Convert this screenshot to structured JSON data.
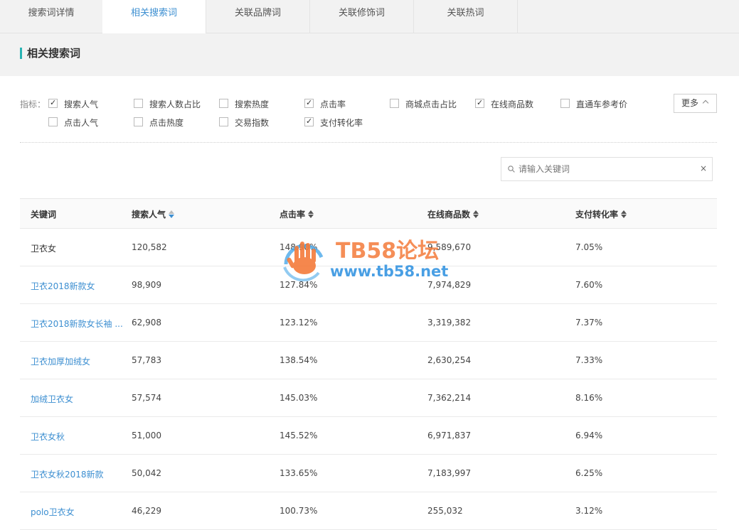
{
  "tabs": [
    {
      "label": "搜索词详情",
      "active": false
    },
    {
      "label": "相关搜索词",
      "active": true
    },
    {
      "label": "关联品牌词",
      "active": false
    },
    {
      "label": "关联修饰词",
      "active": false
    },
    {
      "label": "关联热词",
      "active": false
    }
  ],
  "section": {
    "title": "相关搜索词"
  },
  "indicators": {
    "label": "指标：",
    "options": [
      {
        "label": "搜索人气",
        "checked": true
      },
      {
        "label": "搜索人数占比",
        "checked": false
      },
      {
        "label": "搜索热度",
        "checked": false
      },
      {
        "label": "点击率",
        "checked": true
      },
      {
        "label": "商城点击占比",
        "checked": false
      },
      {
        "label": "在线商品数",
        "checked": true
      },
      {
        "label": "直通车参考价",
        "checked": false
      },
      {
        "label": "点击人气",
        "checked": false
      },
      {
        "label": "点击热度",
        "checked": false
      },
      {
        "label": "交易指数",
        "checked": false
      },
      {
        "label": "支付转化率",
        "checked": true
      }
    ],
    "more_label": "更多"
  },
  "search": {
    "placeholder": "请输入关键词",
    "value": "",
    "clear_symbol": "×"
  },
  "table": {
    "headers": [
      "关键词",
      "搜索人气",
      "点击率",
      "在线商品数",
      "支付转化率"
    ],
    "rows": [
      [
        "卫衣女",
        "120,582",
        "148.90%",
        "9,589,670",
        "7.05%"
      ],
      [
        "卫衣2018新款女",
        "98,909",
        "127.84%",
        "7,974,829",
        "7.60%"
      ],
      [
        "卫衣2018新款女长袖 ...",
        "62,908",
        "123.12%",
        "3,319,382",
        "7.37%"
      ],
      [
        "卫衣加厚加绒女",
        "57,783",
        "138.54%",
        "2,630,254",
        "7.33%"
      ],
      [
        "加绒卫衣女",
        "57,574",
        "145.03%",
        "7,362,214",
        "8.16%"
      ],
      [
        "卫衣女秋",
        "51,000",
        "145.52%",
        "6,971,837",
        "6.94%"
      ],
      [
        "卫衣女秋2018新款",
        "50,042",
        "133.65%",
        "7,183,997",
        "6.25%"
      ],
      [
        "polo卫衣女",
        "46,229",
        "100.73%",
        "255,032",
        "3.12%"
      ]
    ]
  },
  "watermark": {
    "title": "TB58论坛",
    "url": "www.tb58.net"
  },
  "colors": {
    "accent": "#3d8fd1",
    "section_bar": "#29b3b3",
    "watermark_orange": "#f47b3a",
    "watermark_blue": "#2a8fe0"
  }
}
